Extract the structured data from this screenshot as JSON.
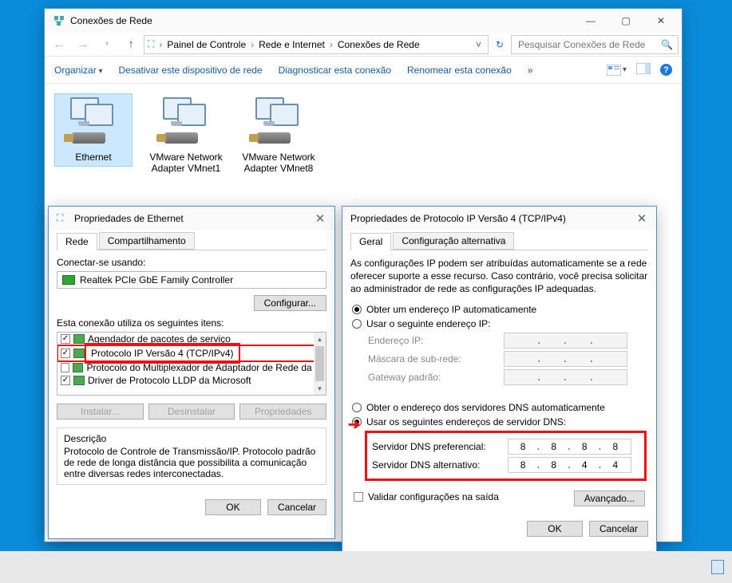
{
  "main_window": {
    "title": "Conexões de Rede",
    "breadcrumb": [
      "Painel de Controle",
      "Rede e Internet",
      "Conexões de Rede"
    ],
    "search_placeholder": "Pesquisar Conexões de Rede",
    "cmdbar": {
      "organize": "Organizar",
      "disable": "Desativar este dispositivo de rede",
      "diagnose": "Diagnosticar esta conexão",
      "rename": "Renomear esta conexão",
      "more": "»"
    },
    "adapters": [
      {
        "name": "Ethernet",
        "selected": true
      },
      {
        "name": "VMware Network Adapter VMnet1",
        "selected": false
      },
      {
        "name": "VMware Network Adapter VMnet8",
        "selected": false
      }
    ]
  },
  "eth_dialog": {
    "title": "Propriedades de Ethernet",
    "tab1": "Rede",
    "tab2": "Compartilhamento",
    "connect_using": "Conectar-se usando:",
    "nic": "Realtek PCIe GbE Family Controller",
    "configure": "Configurar...",
    "items_label": "Esta conexão utiliza os seguintes itens:",
    "items": [
      {
        "checked": true,
        "text": "Agendador de pacotes de serviço",
        "hl": false
      },
      {
        "checked": true,
        "text": "Protocolo IP Versão 4 (TCP/IPv4)",
        "hl": true
      },
      {
        "checked": false,
        "text": "Protocolo do Multiplexador de Adaptador de Rede da M",
        "hl": false
      },
      {
        "checked": true,
        "text": "Driver de Protocolo LLDP da Microsoft",
        "hl": false
      }
    ],
    "install": "Instalar...",
    "uninstall": "Desinstalar",
    "properties": "Propriedades",
    "desc_label": "Descrição",
    "desc": "Protocolo de Controle de Transmissão/IP. Protocolo padrão de rede de longa distância que possibilita a comunicação entre diversas redes interconectadas.",
    "ok": "OK",
    "cancel": "Cancelar"
  },
  "ipv4_dialog": {
    "title": "Propriedades de Protocolo IP Versão 4 (TCP/IPv4)",
    "tab_general": "Geral",
    "tab_alt": "Configuração alternativa",
    "explain": "As configurações IP podem ser atribuídas automaticamente se a rede oferecer suporte a esse recurso. Caso contrário, você precisa solicitar ao administrador de rede as configurações IP adequadas.",
    "r_auto_ip": "Obter um endereço IP automaticamente",
    "r_manual_ip": "Usar o seguinte endereço IP:",
    "ip_label": "Endereço IP:",
    "mask_label": "Máscara de sub-rede:",
    "gw_label": "Gateway padrão:",
    "r_auto_dns": "Obter o endereço dos servidores DNS automaticamente",
    "r_manual_dns": "Usar os seguintes endereços de servidor DNS:",
    "dns_pref_label": "Servidor DNS preferencial:",
    "dns_alt_label": "Servidor DNS alternativo:",
    "dns_pref": [
      "8",
      "8",
      "8",
      "8"
    ],
    "dns_alt": [
      "8",
      "8",
      "4",
      "4"
    ],
    "validate": "Validar configurações na saída",
    "advanced": "Avançado...",
    "ok": "OK",
    "cancel": "Cancelar"
  }
}
